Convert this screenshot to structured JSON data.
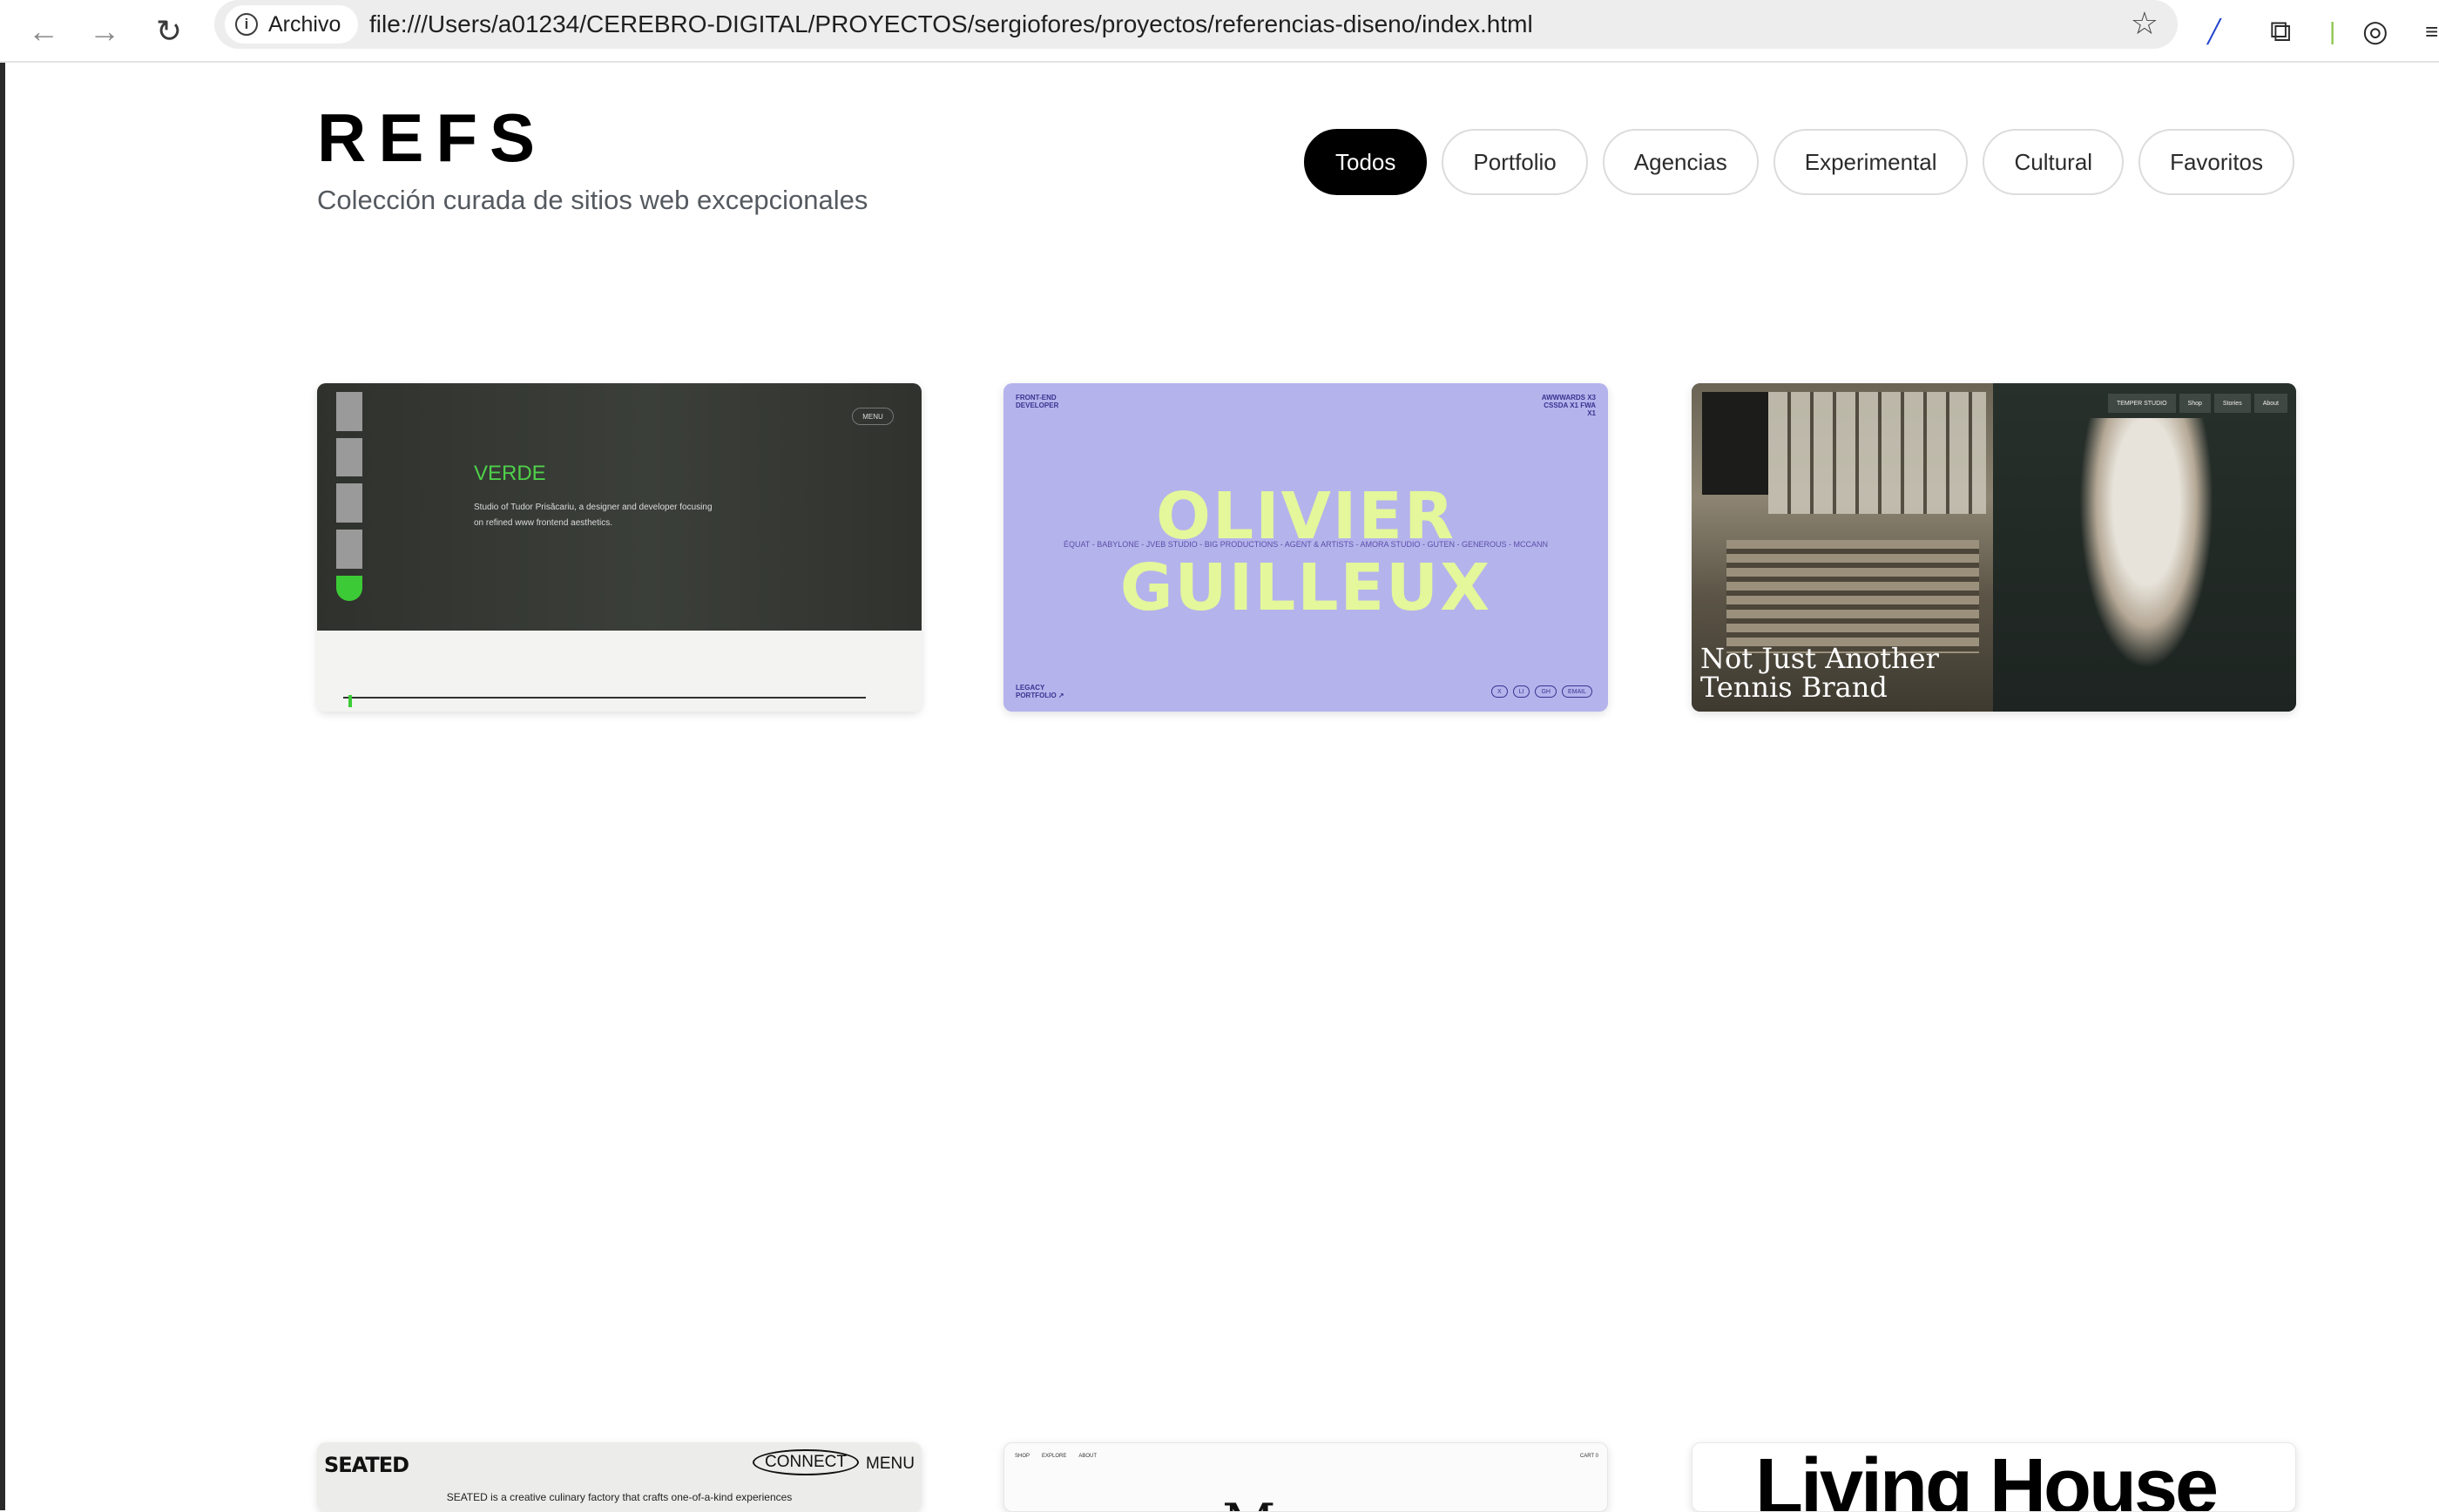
{
  "browser": {
    "origin_chip": "Archivo",
    "url": "file:///Users/a01234/CEREBRO-DIGITAL/PROYECTOS/sergiofores/proyectos/referencias-diseno/index.html"
  },
  "header": {
    "title": "REFS",
    "subtitle": "Colección curada de sitios web excepcionales"
  },
  "filters": [
    "Todos",
    "Portfolio",
    "Agencias",
    "Experimental",
    "Cultural",
    "Favoritos"
  ],
  "active_filter": "Todos",
  "cards": {
    "verde": {
      "title": "VERDE",
      "text": "Studio of Tudor Prisăcariu, a designer and developer focusing on refined www frontend aesthetics.",
      "menu": "MENU"
    },
    "olivier": {
      "name_line1": "OLIVIER",
      "name_line2": "GUILLEUX",
      "corner_tl": "FRONT-END DEVELOPER",
      "corner_tr": "AWWWARDS X3 CSSDA X1 FWA X1",
      "corner_bl": "LEGACY PORTFOLIO ↗",
      "ticker": "ÉQUAT - BABYLONE - JVEB STUDIO - BIG PRODUCTIONS - AGENT & ARTISTS - AMORA STUDIO - GUTEN - GENEROUS - MCCANN",
      "icons": [
        "X",
        "LI",
        "GH",
        "EMAIL"
      ]
    },
    "tennis": {
      "headline": "Not Just Another Tennis Brand",
      "nav": [
        "TEMPER STUDIO",
        "Shop",
        "Stories",
        "About"
      ]
    },
    "seated": {
      "logo": "SEATED",
      "connect": "CONNECT",
      "menu": "MENU",
      "text": "SEATED is a creative culinary factory that crafts one-of-a-kind experiences"
    },
    "middle": {
      "nav": [
        "SHOP",
        "EXPLORE",
        "ABOUT"
      ],
      "right": [
        "CART 0"
      ],
      "glyph": "M"
    },
    "living": {
      "title": "Living House"
    }
  }
}
